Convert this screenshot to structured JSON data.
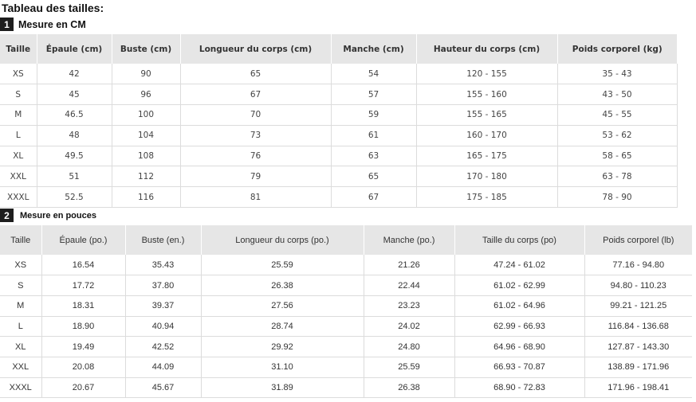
{
  "page_title": "Tableau des tailles:",
  "section_cm": {
    "number": "1",
    "label": "Mesure en CM",
    "headers": [
      "Taille",
      "Épaule (cm)",
      "Buste (cm)",
      "Longueur du corps (cm)",
      "Manche (cm)",
      "Hauteur du corps (cm)",
      "Poids corporel (kg)"
    ],
    "rows": [
      [
        "XS",
        "42",
        "90",
        "65",
        "54",
        "120 - 155",
        "35 - 43"
      ],
      [
        "S",
        "45",
        "96",
        "67",
        "57",
        "155 - 160",
        "43 - 50"
      ],
      [
        "M",
        "46.5",
        "100",
        "70",
        "59",
        "155 - 165",
        "45 - 55"
      ],
      [
        "L",
        "48",
        "104",
        "73",
        "61",
        "160 - 170",
        "53 - 62"
      ],
      [
        "XL",
        "49.5",
        "108",
        "76",
        "63",
        "165 - 175",
        "58 - 65"
      ],
      [
        "XXL",
        "51",
        "112",
        "79",
        "65",
        "170 - 180",
        "63 - 78"
      ],
      [
        "XXXL",
        "52.5",
        "116",
        "81",
        "67",
        "175 - 185",
        "78 - 90"
      ]
    ]
  },
  "section_in": {
    "number": "2",
    "label": "Mesure en pouces",
    "headers": [
      "Taille",
      "Épaule (po.)",
      "Buste (en.)",
      "Longueur du corps (po.)",
      "Manche (po.)",
      "Taille du corps (po)",
      "Poids corporel (lb)"
    ],
    "rows": [
      [
        "XS",
        "16.54",
        "35.43",
        "25.59",
        "21.26",
        "47.24 - 61.02",
        "77.16 - 94.80"
      ],
      [
        "S",
        "17.72",
        "37.80",
        "26.38",
        "22.44",
        "61.02 - 62.99",
        "94.80 - 110.23"
      ],
      [
        "M",
        "18.31",
        "39.37",
        "27.56",
        "23.23",
        "61.02 - 64.96",
        "99.21 - 121.25"
      ],
      [
        "L",
        "18.90",
        "40.94",
        "28.74",
        "24.02",
        "62.99 - 66.93",
        "116.84 - 136.68"
      ],
      [
        "XL",
        "19.49",
        "42.52",
        "29.92",
        "24.80",
        "64.96 - 68.90",
        "127.87 - 143.30"
      ],
      [
        "XXL",
        "20.08",
        "44.09",
        "31.10",
        "25.59",
        "66.93 - 70.87",
        "138.89 - 171.96"
      ],
      [
        "XXXL",
        "20.67",
        "45.67",
        "31.89",
        "26.38",
        "68.90 - 72.83",
        "171.96 - 198.41"
      ]
    ]
  }
}
